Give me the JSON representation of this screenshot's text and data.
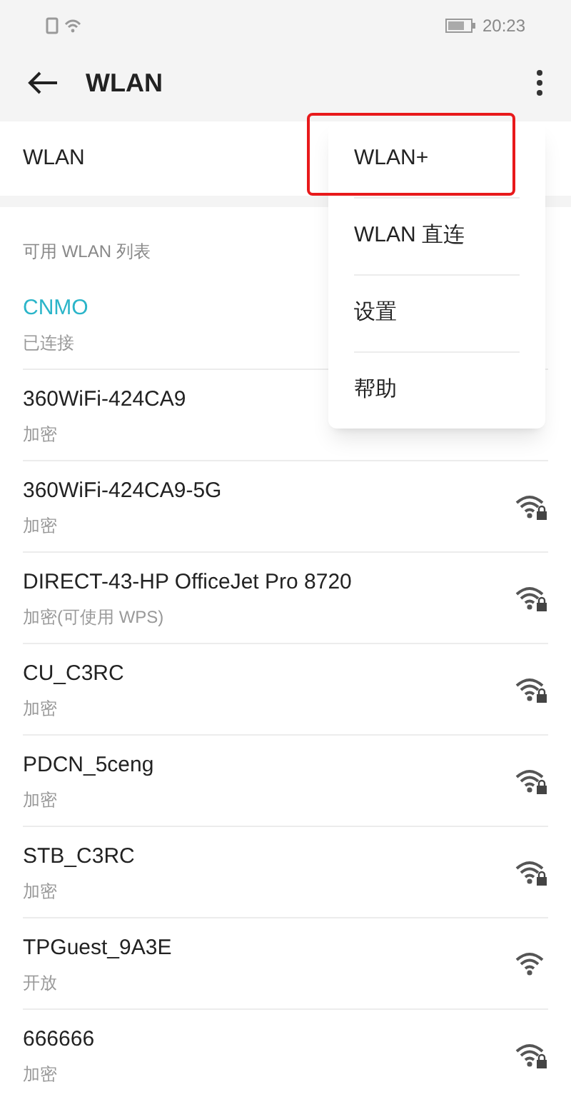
{
  "status_bar": {
    "time": "20:23"
  },
  "header": {
    "title": "WLAN"
  },
  "wlan_row": {
    "label": "WLAN"
  },
  "section_title": "可用 WLAN 列表",
  "networks": [
    {
      "name": "CNMO",
      "status": "已连接",
      "connected": true
    },
    {
      "name": "360WiFi-424CA9",
      "status": "加密",
      "connected": false
    },
    {
      "name": "360WiFi-424CA9-5G",
      "status": "加密",
      "connected": false,
      "secured": true
    },
    {
      "name": "DIRECT-43-HP OfficeJet Pro 8720",
      "status": "加密(可使用 WPS)",
      "connected": false,
      "secured": true
    },
    {
      "name": "CU_C3RC",
      "status": "加密",
      "connected": false,
      "secured": true
    },
    {
      "name": "PDCN_5ceng",
      "status": "加密",
      "connected": false,
      "secured": true
    },
    {
      "name": "STB_C3RC",
      "status": "加密",
      "connected": false,
      "secured": true
    },
    {
      "name": "TPGuest_9A3E",
      "status": "开放",
      "connected": false,
      "secured": false
    },
    {
      "name": "666666",
      "status": "加密",
      "connected": false,
      "secured": true
    }
  ],
  "menu": [
    {
      "label": "WLAN+",
      "highlighted": true
    },
    {
      "label": "WLAN 直连",
      "highlighted": false
    },
    {
      "label": "设置",
      "highlighted": false
    },
    {
      "label": "帮助",
      "highlighted": false
    }
  ]
}
